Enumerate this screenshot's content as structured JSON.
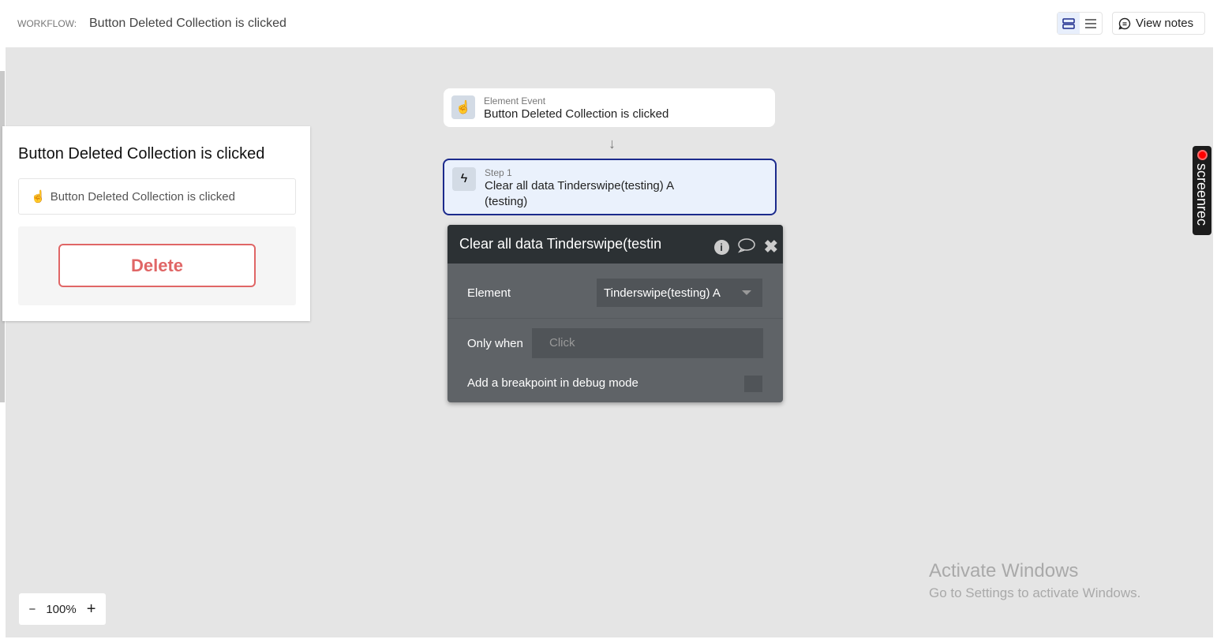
{
  "header": {
    "workflow_label": "WORKFLOW:",
    "workflow_title": "Button Deleted Collection is clicked",
    "view_notes": "View notes"
  },
  "flow": {
    "event": {
      "type": "Element Event",
      "title": "Button Deleted Collection is clicked"
    },
    "step": {
      "label": "Step 1",
      "title": "Clear all data Tinderswipe(testing) A (testing)"
    }
  },
  "popup": {
    "title": "Clear all data Tinderswipe(testin",
    "element_label": "Element",
    "element_value": "Tinderswipe(testing) A",
    "only_when_label": "Only when",
    "only_when_placeholder": "Click",
    "breakpoint_label": "Add a breakpoint in debug mode",
    "breakpoint_checked": false
  },
  "panel": {
    "title": "Button Deleted Collection is clicked",
    "event_text": "Button Deleted Collection is clicked",
    "delete_label": "Delete"
  },
  "zoom": {
    "minus": "−",
    "value": "100%",
    "plus": "+"
  },
  "watermark": {
    "line1": "Activate Windows",
    "line2": "Go to Settings to activate Windows."
  },
  "screenrec": "screenrec",
  "colors": {
    "accent": "#1b2a8c",
    "step_bg": "#eaf1fc",
    "delete": "#e06666",
    "popup_head": "#2c3134",
    "popup_body": "#5f6367"
  }
}
